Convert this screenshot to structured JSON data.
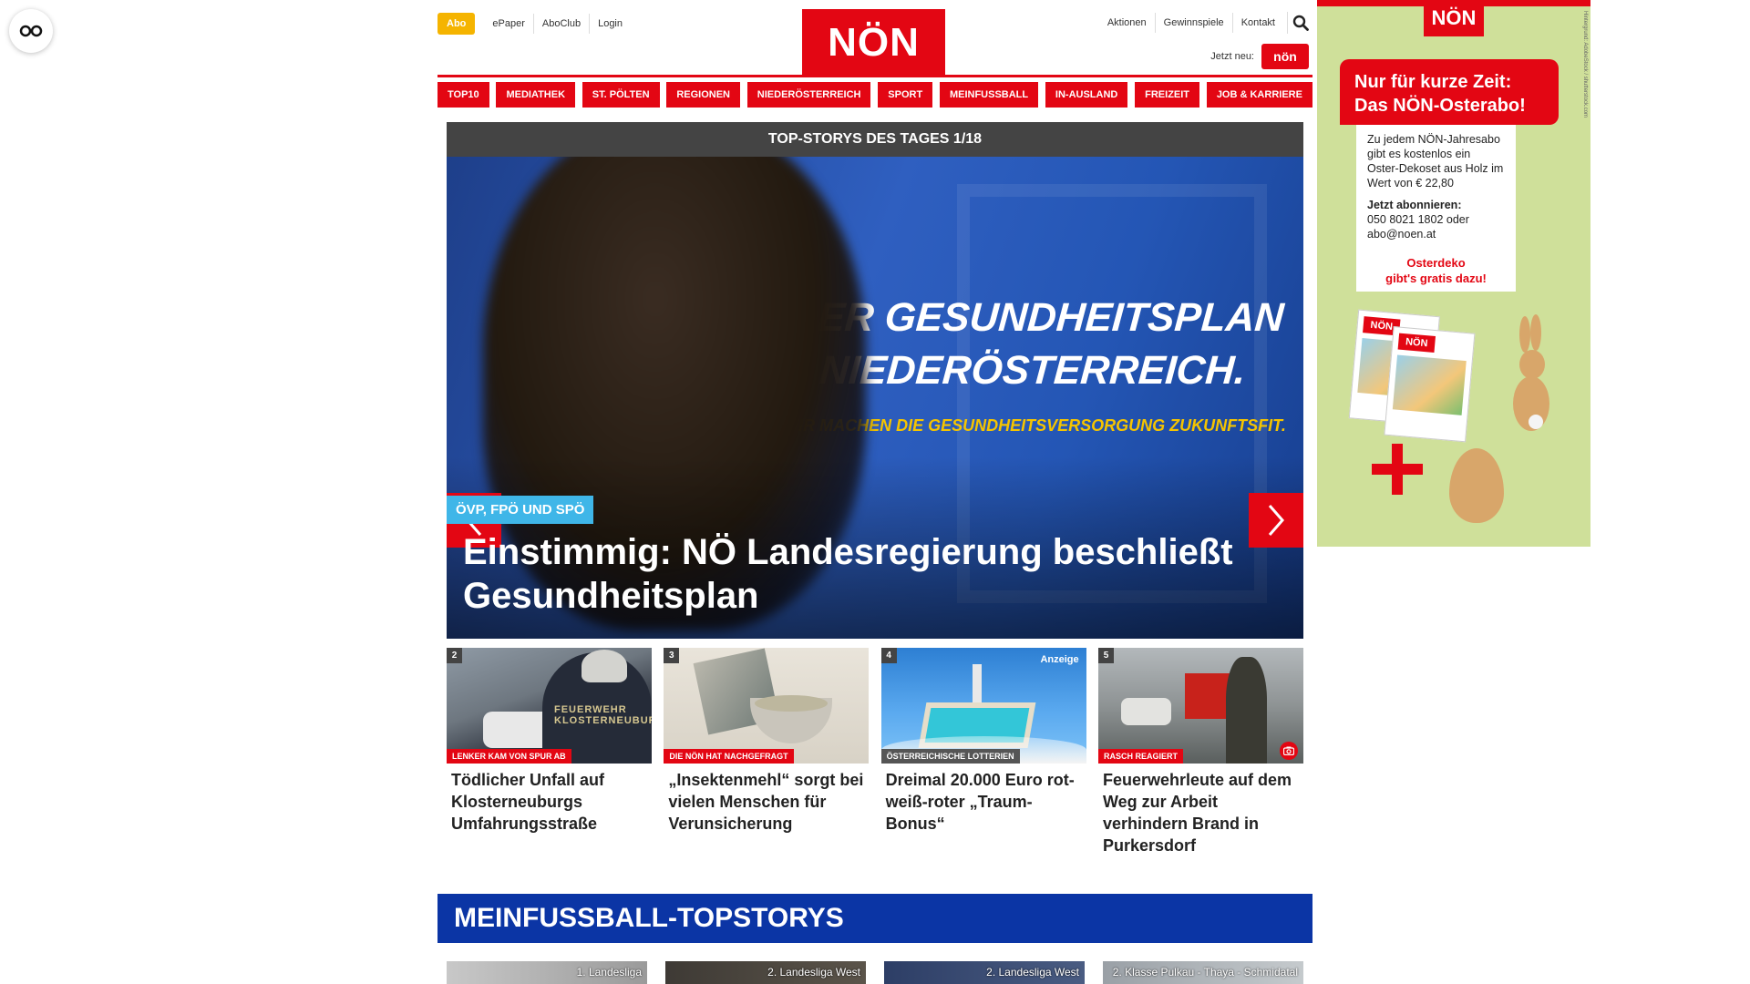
{
  "accessibility": {
    "icon": "accessibility-glasses-icon"
  },
  "header": {
    "abo_label": "Abo",
    "links_left": [
      "ePaper",
      "AboClub",
      "Login"
    ],
    "logo_text": "NÖN",
    "links_right": [
      "Aktionen",
      "Gewinnspiele",
      "Kontakt"
    ],
    "search_icon": "search-icon",
    "jetzt_neu_label": "Jetzt neu:",
    "jetzt_neu_logo": "nön"
  },
  "nav": [
    "TOP10",
    "MEDIATHEK",
    "ST. PÖLTEN",
    "REGIONEN",
    "NIEDERÖSTERREICH",
    "SPORT",
    "MEINFUSSBALL",
    "IN-AUSLAND",
    "FREIZEIT",
    "JOB & KARRIERE"
  ],
  "hero": {
    "bar_title": "TOP-STORYS DES TAGES 1/18",
    "image_line1": "DER GESUNDHEITSPLAN",
    "image_line2": "NIEDERÖSTERREICH.",
    "image_line3": "WIR MACHEN DIE GESUNDHEITSVERSORGUNG ZUKUNFTSFIT.",
    "kicker": "ÖVP, FPÖ UND SPÖ",
    "title": "Einstimmig: NÖ Landesregierung beschließt Gesundheitsplan"
  },
  "teasers": [
    {
      "num": "2",
      "kicker": "LENKER KAM VON SPUR AB",
      "title": "Tödlicher Unfall auf Klosterneuburgs Umfahrungsstraße",
      "image_text": "FEUERWEHR KLOSTERNEUBURG"
    },
    {
      "num": "3",
      "kicker": "DIE NÖN HAT NACHGEFRAGT",
      "title": "„Insektenmehl“ sorgt bei vielen Menschen für Verunsicherung"
    },
    {
      "num": "4",
      "kicker": "ÖSTERREICHISCHE LOTTERIEN",
      "anzeige": "Anzeige",
      "title": "Dreimal 20.000 Euro rot-weiß-roter „Traum-Bonus“"
    },
    {
      "num": "5",
      "kicker": "RASCH REAGIERT",
      "title": "Feuerwehrleute auf dem Weg zur Arbeit verhindern Brand in Purkersdorf"
    }
  ],
  "section": {
    "title": "MEINFUSSBALL-TOPSTORYS",
    "items": [
      "1. Landesliga",
      "2. Landesliga West",
      "2. Landesliga West",
      "2. Klasse Pulkau - Thaya - Schmidatal"
    ]
  },
  "ad": {
    "logo": "NÖN",
    "side_text": "Hintergrund: AdobeStock / shutterstock.com",
    "banner_line1": "Nur für kurze Zeit:",
    "banner_line2": "Das NÖN-Osterabo!",
    "body": "Zu jedem NÖN-Jahresabo gibt es kostenlos ein Oster-Dekoset aus Holz im Wert von € 22,80",
    "cta_title": "Jetzt abonnieren:",
    "cta_body": "050 8021 1802 oder abo@noen.at",
    "footer_line1": "Osterdeko",
    "footer_line2": "gibt's gratis dazu!"
  }
}
